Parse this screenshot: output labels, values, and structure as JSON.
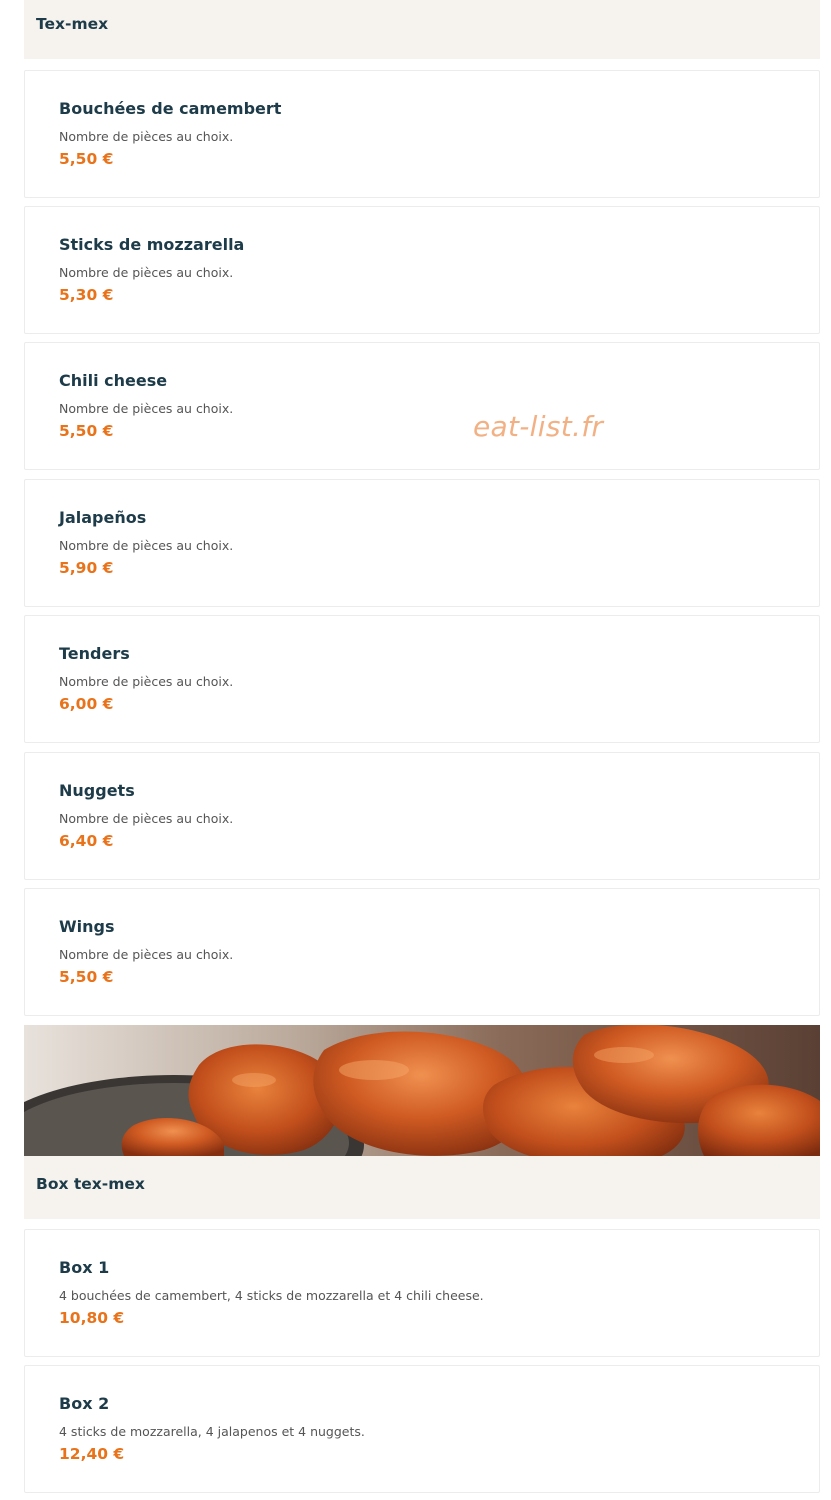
{
  "sections": [
    {
      "title": "Tex-mex",
      "items": [
        {
          "name": "Bouchées de camembert",
          "desc": "Nombre de pièces au choix.",
          "price": "5,50 €"
        },
        {
          "name": "Sticks de mozzarella",
          "desc": "Nombre de pièces au choix.",
          "price": "5,30 €"
        },
        {
          "name": "Chili cheese",
          "desc": "Nombre de pièces au choix.",
          "price": "5,50 €"
        },
        {
          "name": "Jalapeños",
          "desc": "Nombre de pièces au choix.",
          "price": "5,90 €"
        },
        {
          "name": "Tenders",
          "desc": "Nombre de pièces au choix.",
          "price": "6,00 €"
        },
        {
          "name": "Nuggets",
          "desc": "Nombre de pièces au choix.",
          "price": "6,40 €"
        },
        {
          "name": "Wings",
          "desc": "Nombre de pièces au choix.",
          "price": "5,50 €"
        }
      ]
    },
    {
      "title": "Box tex-mex",
      "items": [
        {
          "name": "Box 1",
          "desc": "4 bouchées de camembert, 4 sticks de mozzarella et 4 chili cheese.",
          "price": "10,80 €"
        },
        {
          "name": "Box 2",
          "desc": "4 sticks de mozzarella, 4 jalapenos et 4 nuggets.",
          "price": "12,40 €"
        }
      ]
    }
  ],
  "watermark": "eat-list.fr",
  "banner_image": "chicken-wings-photo",
  "colors": {
    "header_bg": "#f6f3ef",
    "title_text": "#1d3b48",
    "price": "#e8731b",
    "watermark": "#f2b184"
  }
}
